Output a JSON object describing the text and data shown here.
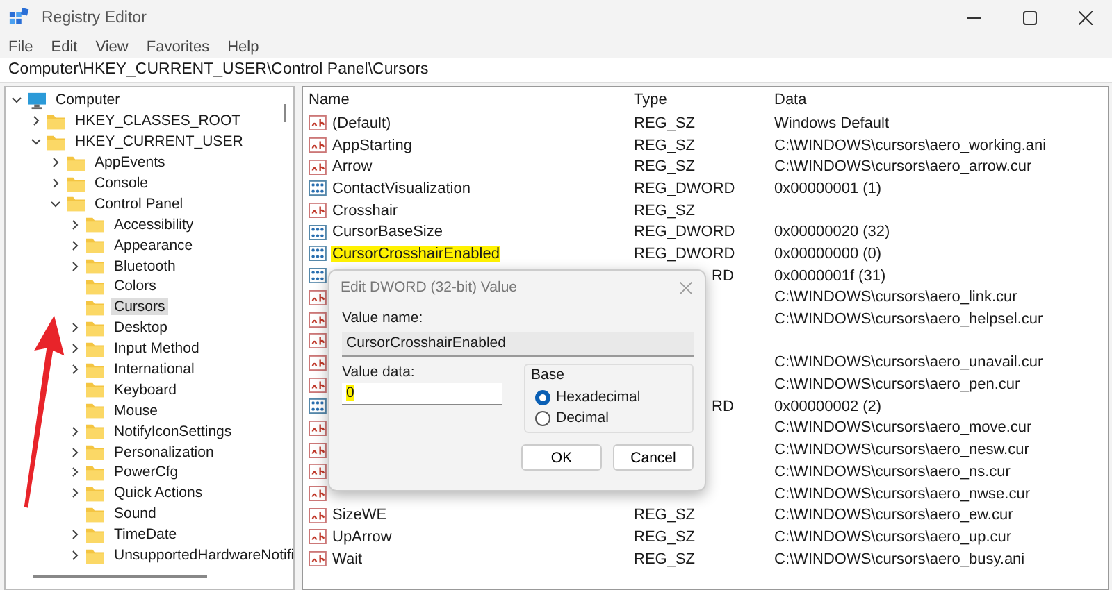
{
  "window": {
    "title": "Registry Editor"
  },
  "menu": [
    "File",
    "Edit",
    "View",
    "Favorites",
    "Help"
  ],
  "address": "Computer\\HKEY_CURRENT_USER\\Control Panel\\Cursors",
  "tree": [
    {
      "label": "Computer",
      "kind": "computer",
      "expanded": true,
      "selected": false,
      "children": [
        {
          "label": "HKEY_CLASSES_ROOT",
          "kind": "branch",
          "expanded": false,
          "selected": false
        },
        {
          "label": "HKEY_CURRENT_USER",
          "kind": "branch",
          "expanded": true,
          "selected": false,
          "children": [
            {
              "label": "AppEvents",
              "kind": "branch",
              "expanded": false,
              "selected": false
            },
            {
              "label": "Console",
              "kind": "branch",
              "expanded": false,
              "selected": false
            },
            {
              "label": "Control Panel",
              "kind": "branch",
              "expanded": true,
              "selected": false,
              "children": [
                {
                  "label": "Accessibility",
                  "kind": "branch",
                  "expanded": false,
                  "selected": false
                },
                {
                  "label": "Appearance",
                  "kind": "branch",
                  "expanded": false,
                  "selected": false
                },
                {
                  "label": "Bluetooth",
                  "kind": "branch",
                  "expanded": false,
                  "selected": false
                },
                {
                  "label": "Colors",
                  "kind": "leaf",
                  "selected": false
                },
                {
                  "label": "Cursors",
                  "kind": "leaf",
                  "selected": true
                },
                {
                  "label": "Desktop",
                  "kind": "branch",
                  "expanded": false,
                  "selected": false
                },
                {
                  "label": "Input Method",
                  "kind": "branch",
                  "expanded": false,
                  "selected": false
                },
                {
                  "label": "International",
                  "kind": "branch",
                  "expanded": false,
                  "selected": false
                },
                {
                  "label": "Keyboard",
                  "kind": "leaf",
                  "selected": false
                },
                {
                  "label": "Mouse",
                  "kind": "leaf",
                  "selected": false
                },
                {
                  "label": "NotifyIconSettings",
                  "kind": "branch",
                  "expanded": false,
                  "selected": false
                },
                {
                  "label": "Personalization",
                  "kind": "branch",
                  "expanded": false,
                  "selected": false
                },
                {
                  "label": "PowerCfg",
                  "kind": "branch",
                  "expanded": false,
                  "selected": false
                },
                {
                  "label": "Quick Actions",
                  "kind": "branch",
                  "expanded": false,
                  "selected": false
                },
                {
                  "label": "Sound",
                  "kind": "leaf",
                  "selected": false
                },
                {
                  "label": "TimeDate",
                  "kind": "branch",
                  "expanded": false,
                  "selected": false
                },
                {
                  "label": "UnsupportedHardwareNotifi",
                  "kind": "branch",
                  "expanded": false,
                  "selected": false
                }
              ]
            }
          ]
        }
      ]
    }
  ],
  "list": {
    "columns": [
      "Name",
      "Type",
      "Data"
    ],
    "rows": [
      {
        "kind": "string",
        "name": "(Default)",
        "type": "REG_SZ",
        "data": "Windows Default",
        "highlighted": false
      },
      {
        "kind": "string",
        "name": "AppStarting",
        "type": "REG_SZ",
        "data": "C:\\WINDOWS\\cursors\\aero_working.ani",
        "highlighted": false
      },
      {
        "kind": "string",
        "name": "Arrow",
        "type": "REG_SZ",
        "data": "C:\\WINDOWS\\cursors\\aero_arrow.cur",
        "highlighted": false
      },
      {
        "kind": "dword",
        "name": "ContactVisualization",
        "type": "REG_DWORD",
        "data": "0x00000001 (1)",
        "highlighted": false
      },
      {
        "kind": "string",
        "name": "Crosshair",
        "type": "REG_SZ",
        "highlighted": false
      },
      {
        "kind": "dword",
        "name": "CursorBaseSize",
        "type": "REG_DWORD",
        "data": "0x00000020 (32)",
        "highlighted": false
      },
      {
        "kind": "dword",
        "name": "CursorCrosshairEnabled",
        "type": "REG_DWORD",
        "data": "0x00000000 (0)",
        "highlighted": true
      },
      {
        "kind": "dword",
        "type": "RD",
        "data": "0x0000001f (31)"
      },
      {
        "kind": "string",
        "data": "C:\\WINDOWS\\cursors\\aero_link.cur"
      },
      {
        "kind": "string",
        "data": "C:\\WINDOWS\\cursors\\aero_helpsel.cur"
      },
      {
        "kind": "string"
      },
      {
        "kind": "string",
        "data": "C:\\WINDOWS\\cursors\\aero_unavail.cur"
      },
      {
        "kind": "string",
        "data": "C:\\WINDOWS\\cursors\\aero_pen.cur"
      },
      {
        "kind": "dword",
        "type": "RD",
        "data": "0x00000002 (2)"
      },
      {
        "kind": "string",
        "data": "C:\\WINDOWS\\cursors\\aero_move.cur"
      },
      {
        "kind": "string",
        "data": "C:\\WINDOWS\\cursors\\aero_nesw.cur"
      },
      {
        "kind": "string",
        "data": "C:\\WINDOWS\\cursors\\aero_ns.cur"
      },
      {
        "kind": "string",
        "data": "C:\\WINDOWS\\cursors\\aero_nwse.cur"
      },
      {
        "kind": "string",
        "name": "SizeWE",
        "type": "REG_SZ",
        "data": "C:\\WINDOWS\\cursors\\aero_ew.cur",
        "highlighted": false
      },
      {
        "kind": "string",
        "name": "UpArrow",
        "type": "REG_SZ",
        "data": "C:\\WINDOWS\\cursors\\aero_up.cur",
        "highlighted": false
      },
      {
        "kind": "string",
        "name": "Wait",
        "type": "REG_SZ",
        "data": "C:\\WINDOWS\\cursors\\aero_busy.ani",
        "highlighted": false
      }
    ]
  },
  "dialog": {
    "title": "Edit DWORD (32-bit) Value",
    "value_name_label": "Value name:",
    "value_name": "CursorCrosshairEnabled",
    "value_data_label": "Value data:",
    "value_data": "0",
    "value_data_highlighted": true,
    "base_label": "Base",
    "radios": [
      {
        "label": "Hexadecimal",
        "selected": true
      },
      {
        "label": "Decimal",
        "selected": false
      }
    ],
    "buttons": [
      "OK",
      "Cancel"
    ]
  }
}
